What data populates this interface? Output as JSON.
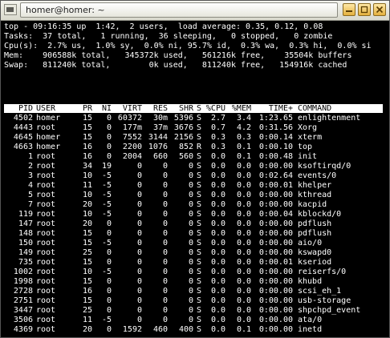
{
  "window": {
    "title": "homer@homer: ~"
  },
  "summary": [
    "top - 09:16:35 up  1:42,  2 users,  load average: 0.35, 0.12, 0.08",
    "Tasks:  37 total,   1 running,  36 sleeping,   0 stopped,   0 zombie",
    "Cpu(s):  2.7% us,  1.0% sy,  0.0% ni, 95.7% id,  0.3% wa,  0.3% hi,  0.0% si",
    "Mem:    906588k total,   345372k used,   561216k free,    35504k buffers",
    "Swap:   811240k total,        0k used,   811240k free,   154916k cached"
  ],
  "columns": [
    "PID",
    "USER",
    "PR",
    "NI",
    "VIRT",
    "RES",
    "SHR",
    "S",
    "%CPU",
    "%MEM",
    "TIME+",
    "COMMAND"
  ],
  "processes": [
    [
      "4502",
      "homer",
      "15",
      "0",
      "60372",
      "30m",
      "5396",
      "S",
      "2.7",
      "3.4",
      "1:23.65",
      "enlightenment"
    ],
    [
      "4443",
      "root",
      "15",
      "0",
      "177m",
      "37m",
      "3676",
      "S",
      "0.7",
      "4.2",
      "0:31.56",
      "Xorg"
    ],
    [
      "4645",
      "homer",
      "15",
      "0",
      "7552",
      "3144",
      "2156",
      "S",
      "0.3",
      "0.3",
      "0:00.14",
      "xterm"
    ],
    [
      "4663",
      "homer",
      "16",
      "0",
      "2200",
      "1076",
      "852",
      "R",
      "0.3",
      "0.1",
      "0:00.10",
      "top"
    ],
    [
      "1",
      "root",
      "16",
      "0",
      "2004",
      "660",
      "560",
      "S",
      "0.0",
      "0.1",
      "0:00.48",
      "init"
    ],
    [
      "2",
      "root",
      "34",
      "19",
      "0",
      "0",
      "0",
      "S",
      "0.0",
      "0.0",
      "0:00.00",
      "ksoftirqd/0"
    ],
    [
      "3",
      "root",
      "10",
      "-5",
      "0",
      "0",
      "0",
      "S",
      "0.0",
      "0.0",
      "0:02.64",
      "events/0"
    ],
    [
      "4",
      "root",
      "11",
      "-5",
      "0",
      "0",
      "0",
      "S",
      "0.0",
      "0.0",
      "0:00.01",
      "khelper"
    ],
    [
      "5",
      "root",
      "10",
      "-5",
      "0",
      "0",
      "0",
      "S",
      "0.0",
      "0.0",
      "0:00.00",
      "kthread"
    ],
    [
      "7",
      "root",
      "20",
      "-5",
      "0",
      "0",
      "0",
      "S",
      "0.0",
      "0.0",
      "0:00.00",
      "kacpid"
    ],
    [
      "119",
      "root",
      "10",
      "-5",
      "0",
      "0",
      "0",
      "S",
      "0.0",
      "0.0",
      "0:00.04",
      "kblockd/0"
    ],
    [
      "147",
      "root",
      "20",
      "0",
      "0",
      "0",
      "0",
      "S",
      "0.0",
      "0.0",
      "0:00.00",
      "pdflush"
    ],
    [
      "148",
      "root",
      "15",
      "0",
      "0",
      "0",
      "0",
      "S",
      "0.0",
      "0.0",
      "0:00.00",
      "pdflush"
    ],
    [
      "150",
      "root",
      "15",
      "-5",
      "0",
      "0",
      "0",
      "S",
      "0.0",
      "0.0",
      "0:00.00",
      "aio/0"
    ],
    [
      "149",
      "root",
      "25",
      "0",
      "0",
      "0",
      "0",
      "S",
      "0.0",
      "0.0",
      "0:00.00",
      "kswapd0"
    ],
    [
      "735",
      "root",
      "15",
      "0",
      "0",
      "0",
      "0",
      "S",
      "0.0",
      "0.0",
      "0:00.01",
      "kseriod"
    ],
    [
      "1002",
      "root",
      "10",
      "-5",
      "0",
      "0",
      "0",
      "S",
      "0.0",
      "0.0",
      "0:00.00",
      "reiserfs/0"
    ],
    [
      "1998",
      "root",
      "15",
      "0",
      "0",
      "0",
      "0",
      "S",
      "0.0",
      "0.0",
      "0:00.00",
      "khubd"
    ],
    [
      "2728",
      "root",
      "16",
      "0",
      "0",
      "0",
      "0",
      "S",
      "0.0",
      "0.0",
      "0:00.00",
      "scsi_eh_1"
    ],
    [
      "2751",
      "root",
      "15",
      "0",
      "0",
      "0",
      "0",
      "S",
      "0.0",
      "0.0",
      "0:00.00",
      "usb-storage"
    ],
    [
      "3447",
      "root",
      "25",
      "0",
      "0",
      "0",
      "0",
      "S",
      "0.0",
      "0.0",
      "0:00.00",
      "shpchpd_event"
    ],
    [
      "3506",
      "root",
      "11",
      "-5",
      "0",
      "0",
      "0",
      "S",
      "0.0",
      "0.0",
      "0:00.00",
      "ata/0"
    ],
    [
      "4369",
      "root",
      "20",
      "0",
      "1592",
      "460",
      "400",
      "S",
      "0.0",
      "0.1",
      "0:00.00",
      "inetd"
    ]
  ]
}
